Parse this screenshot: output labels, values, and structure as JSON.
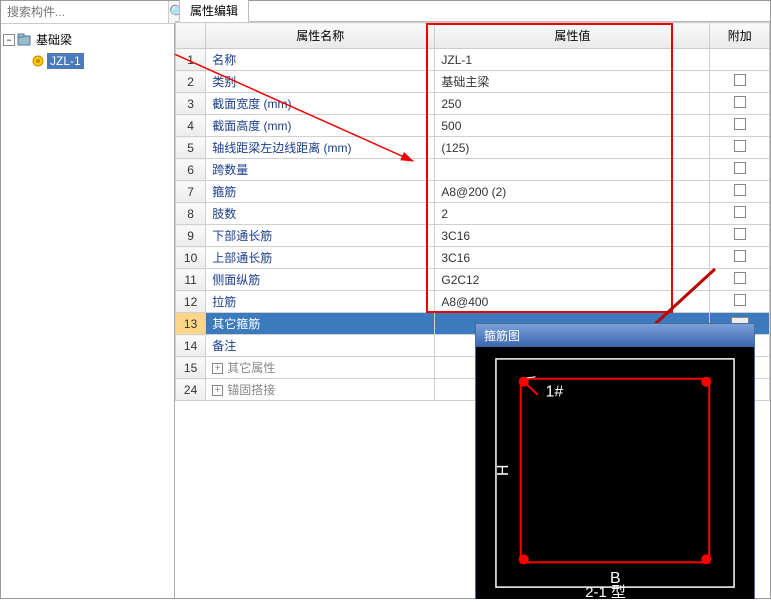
{
  "search": {
    "placeholder": "搜索构件..."
  },
  "tree": {
    "root": {
      "label": "基础梁"
    },
    "child": {
      "label": "JZL-1"
    }
  },
  "tab": {
    "label": "属性编辑"
  },
  "headers": {
    "name": "属性名称",
    "value": "属性值",
    "add": "附加"
  },
  "rows": [
    {
      "n": "1",
      "name": "名称",
      "value": "JZL-1",
      "check": false,
      "link": true
    },
    {
      "n": "2",
      "name": "类别",
      "value": "基础主梁",
      "check": true,
      "link": true
    },
    {
      "n": "3",
      "name": "截面宽度 (mm)",
      "value": "250",
      "check": true,
      "link": true
    },
    {
      "n": "4",
      "name": "截面高度 (mm)",
      "value": "500",
      "check": true,
      "link": true
    },
    {
      "n": "5",
      "name": "轴线距梁左边线距离 (mm)",
      "value": " (125)",
      "check": true,
      "link": true
    },
    {
      "n": "6",
      "name": "跨数量",
      "value": "",
      "check": true,
      "link": true
    },
    {
      "n": "7",
      "name": "箍筋",
      "value": "A8@200 (2)",
      "check": true,
      "link": true
    },
    {
      "n": "8",
      "name": "肢数",
      "value": "2",
      "check": true,
      "link": true
    },
    {
      "n": "9",
      "name": "下部通长筋",
      "value": "3C16",
      "check": true,
      "link": true
    },
    {
      "n": "10",
      "name": "上部通长筋",
      "value": "3C16",
      "check": true,
      "link": true
    },
    {
      "n": "11",
      "name": "侧面纵筋",
      "value": "G2C12",
      "check": true,
      "link": true
    },
    {
      "n": "12",
      "name": "拉筋",
      "value": "A8@400",
      "check": true,
      "link": true
    },
    {
      "n": "13",
      "name": "其它箍筋",
      "value": "",
      "check": false,
      "selected": true,
      "ellipsis": true,
      "link": true
    },
    {
      "n": "14",
      "name": "备注",
      "value": "",
      "check": true,
      "link": true
    },
    {
      "n": "15",
      "name": "其它属性",
      "value": "",
      "expand": true,
      "gray": true
    },
    {
      "n": "24",
      "name": "锚固搭接",
      "value": "",
      "expand": true,
      "gray": true
    }
  ],
  "stirrup": {
    "title": "箍筋图",
    "label1": "1#",
    "labelH": "H",
    "labelB": "B",
    "labelType": "2-1 型"
  }
}
